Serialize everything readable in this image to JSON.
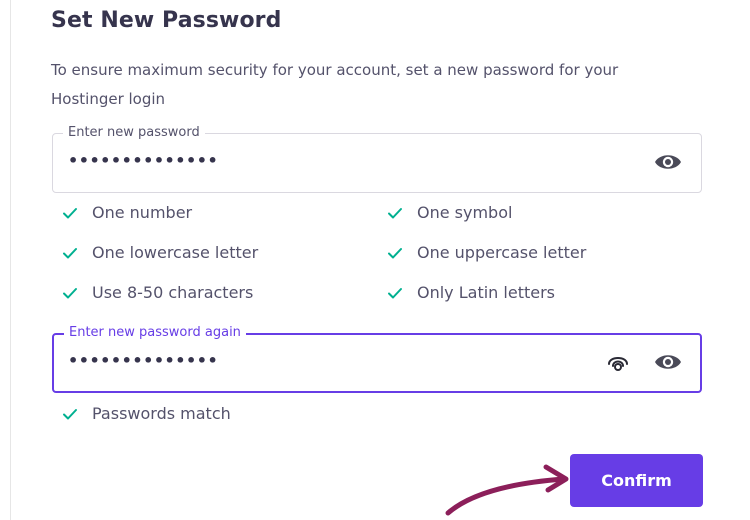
{
  "header": {
    "title": "Set New Password",
    "subtitle": "To ensure maximum security for your account, set a new password for your Hostinger login"
  },
  "new_password": {
    "label": "Enter new password",
    "value": "••••••••••••••"
  },
  "requirements": [
    {
      "label": "One number",
      "met": true
    },
    {
      "label": "One symbol",
      "met": true
    },
    {
      "label": "One lowercase letter",
      "met": true
    },
    {
      "label": "One uppercase letter",
      "met": true
    },
    {
      "label": "Use 8-50 characters",
      "met": true
    },
    {
      "label": "Only Latin letters",
      "met": true
    }
  ],
  "confirm_password": {
    "label": "Enter new password again",
    "value": "••••••••••••••"
  },
  "match_status": {
    "label": "Passwords match",
    "met": true
  },
  "actions": {
    "confirm_label": "Confirm"
  },
  "icons": {
    "eye": "eye-icon",
    "fingerprint": "fingerprint-icon",
    "check": "check-icon",
    "arrow": "annotation-arrow-icon"
  },
  "colors": {
    "accent": "#673de6",
    "check": "#00b090",
    "title": "#36344d",
    "text": "#54526b",
    "annotation_arrow": "#8c1f5a"
  }
}
